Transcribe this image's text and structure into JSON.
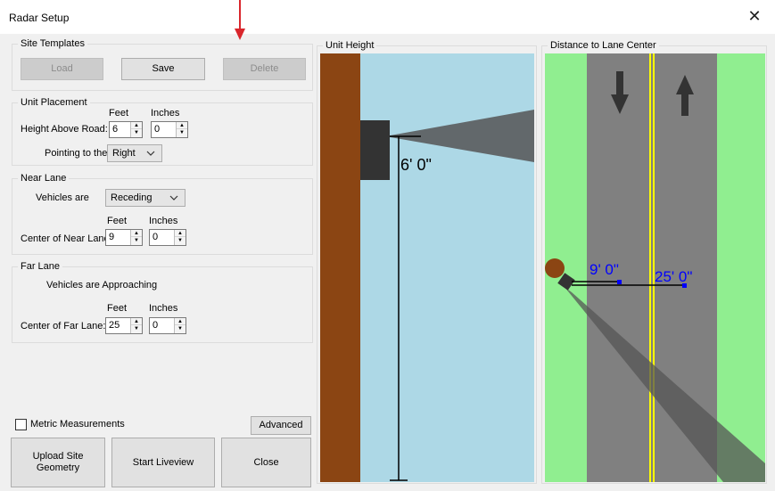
{
  "window": {
    "title": "Radar Setup",
    "close_glyph": "✕"
  },
  "site_templates": {
    "label": "Site Templates",
    "load_label": "Load",
    "save_label": "Save",
    "delete_label": "Delete"
  },
  "unit_placement": {
    "label": "Unit Placement",
    "feet_header": "Feet",
    "inches_header": "Inches",
    "height_label": "Height Above Road:",
    "height_feet": "6",
    "height_inches": "0",
    "pointing_label": "Pointing to the",
    "pointing_value": "Right"
  },
  "near_lane": {
    "label": "Near Lane",
    "vehicles_label": "Vehicles are",
    "vehicles_value": "Receding",
    "feet_header": "Feet",
    "inches_header": "Inches",
    "center_label": "Center of Near Lane:",
    "center_feet": "9",
    "center_inches": "0"
  },
  "far_lane": {
    "label": "Far Lane",
    "vehicles_text": "Vehicles are Approaching",
    "feet_header": "Feet",
    "inches_header": "Inches",
    "center_label": "Center of Far Lane:",
    "center_feet": "25",
    "center_inches": "0"
  },
  "options": {
    "metric_label": "Metric  Measurements",
    "metric_checked": false,
    "advanced_label": "Advanced"
  },
  "actions": {
    "upload_label": "Upload Site Geometry",
    "liveview_label": "Start Liveview",
    "close_label": "Close"
  },
  "unit_height_panel": {
    "label": "Unit Height",
    "height_text": "6' 0\""
  },
  "lane_panel": {
    "label": "Distance to Lane Center",
    "near_distance_text": "9' 0\"",
    "far_distance_text": "25' 0\""
  },
  "colors": {
    "accent_pointer": "#d9262c",
    "pole": "#8b4513",
    "sky": "#add8e6",
    "grass": "#90ee90",
    "road": "#808080",
    "lane_line": "#ffff00",
    "distance_text": "#0000ff",
    "radar_unit": "#333333"
  },
  "icons": {
    "pointer": "down-arrow-pointer-icon",
    "lane_arrows": [
      "down-arrow-icon",
      "up-arrow-icon"
    ],
    "chevrons": "chevron-down-icon"
  }
}
